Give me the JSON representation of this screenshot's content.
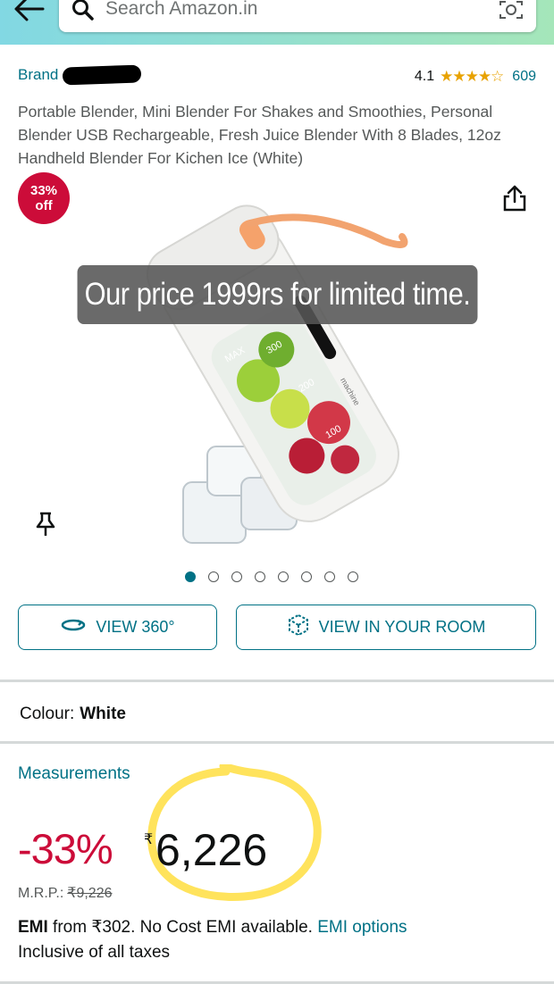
{
  "search": {
    "placeholder": "Search Amazon.in"
  },
  "product": {
    "brand_label": "Brand",
    "rating_value": "4.1",
    "rating_stars": "★★★★☆",
    "rating_count": "609",
    "title": "Portable Blender, Mini Blender For Shakes and Smoothies, Personal Blender USB Rechargeable, Fresh Juice Blender With 8 Blades, 12oz Handheld Blender For Kichen Ice (White)",
    "badge_pct": "33%",
    "badge_off": "off",
    "overlay_text": "Our price 1999rs for limited time.",
    "image_count": 8,
    "active_image": 1,
    "markings": {
      "max": "MAX",
      "m300": "300",
      "m200": "200",
      "m100": "100",
      "brand_side": "machine"
    }
  },
  "actions": {
    "view360": "VIEW 360°",
    "view_room": "VIEW IN YOUR ROOM"
  },
  "colour": {
    "label": "Colour:",
    "value": "White"
  },
  "measurements": {
    "label": "Measurements"
  },
  "pricing": {
    "discount": "-33%",
    "currency_symbol": "₹",
    "price": "6,226",
    "mrp_label": "M.R.P.:",
    "mrp_value": "₹9,226"
  },
  "emi": {
    "prefix": "EMI",
    "text": " from ₹302. No Cost EMI available. ",
    "link": "EMI options"
  },
  "tax_note": "Inclusive of all taxes",
  "colors": {
    "teal": "#007185",
    "deal_red": "#cc0c39",
    "star": "#e8a200",
    "highlight": "#ffe04a"
  }
}
